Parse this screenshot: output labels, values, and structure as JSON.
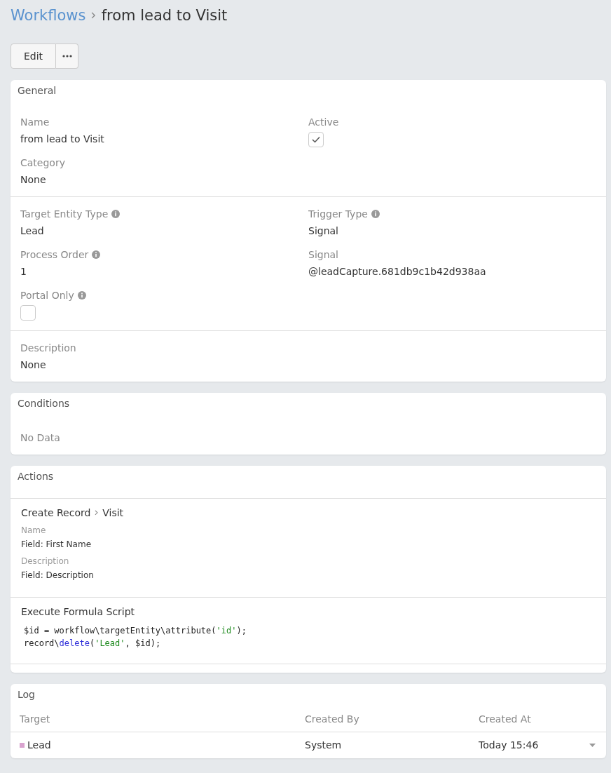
{
  "breadcrumb": {
    "parent": "Workflows",
    "current": "from lead to Visit"
  },
  "buttons": {
    "edit": "Edit"
  },
  "general": {
    "title": "General",
    "sections": [
      {
        "columns": [
          [
            {
              "label": "Name",
              "kind": "text",
              "value": "from lead to Visit",
              "info": false
            },
            {
              "label": "Category",
              "kind": "text",
              "value": "None",
              "info": false
            }
          ],
          [
            {
              "label": "Active",
              "kind": "checkbox",
              "checked": true,
              "info": false
            }
          ]
        ]
      },
      {
        "columns": [
          [
            {
              "label": "Target Entity Type",
              "kind": "text",
              "value": "Lead",
              "info": true
            },
            {
              "label": "Process Order",
              "kind": "text",
              "value": "1",
              "info": true
            },
            {
              "label": "Portal Only",
              "kind": "checkbox",
              "checked": false,
              "info": true
            }
          ],
          [
            {
              "label": "Trigger Type",
              "kind": "text",
              "value": "Signal",
              "info": true
            },
            {
              "label": "Signal",
              "kind": "text",
              "value": "@leadCapture.681db9c1b42d938aa",
              "info": false
            }
          ]
        ]
      },
      {
        "columns": [
          [
            {
              "label": "Description",
              "kind": "text",
              "value": "None",
              "info": false
            }
          ]
        ]
      }
    ]
  },
  "conditions": {
    "title": "Conditions",
    "empty": "No Data"
  },
  "actions": {
    "title": "Actions",
    "items": [
      {
        "kind": "create",
        "type": "Create Record",
        "target": "Visit",
        "fields": [
          {
            "label": "Name",
            "value": "Field: First Name"
          },
          {
            "label": "Description",
            "value": "Field: Description"
          }
        ]
      },
      {
        "kind": "script",
        "type": "Execute Formula Script",
        "code": [
          [
            {
              "kind": "plain",
              "text": "$id = workflow\\targetEntity\\attribute("
            },
            {
              "kind": "string",
              "text": "'id'"
            },
            {
              "kind": "plain",
              "text": ");"
            }
          ],
          [
            {
              "kind": "plain",
              "text": "record\\"
            },
            {
              "kind": "function",
              "text": "delete"
            },
            {
              "kind": "plain",
              "text": "("
            },
            {
              "kind": "string",
              "text": "'Lead'"
            },
            {
              "kind": "plain",
              "text": ", $id);"
            }
          ]
        ]
      }
    ]
  },
  "log": {
    "title": "Log",
    "columns": [
      "Target",
      "Created By",
      "Created At"
    ],
    "rows": [
      {
        "target": "Lead",
        "color": "#d9a3cf",
        "created_by": "System",
        "created_at": "Today 15:46"
      }
    ]
  }
}
